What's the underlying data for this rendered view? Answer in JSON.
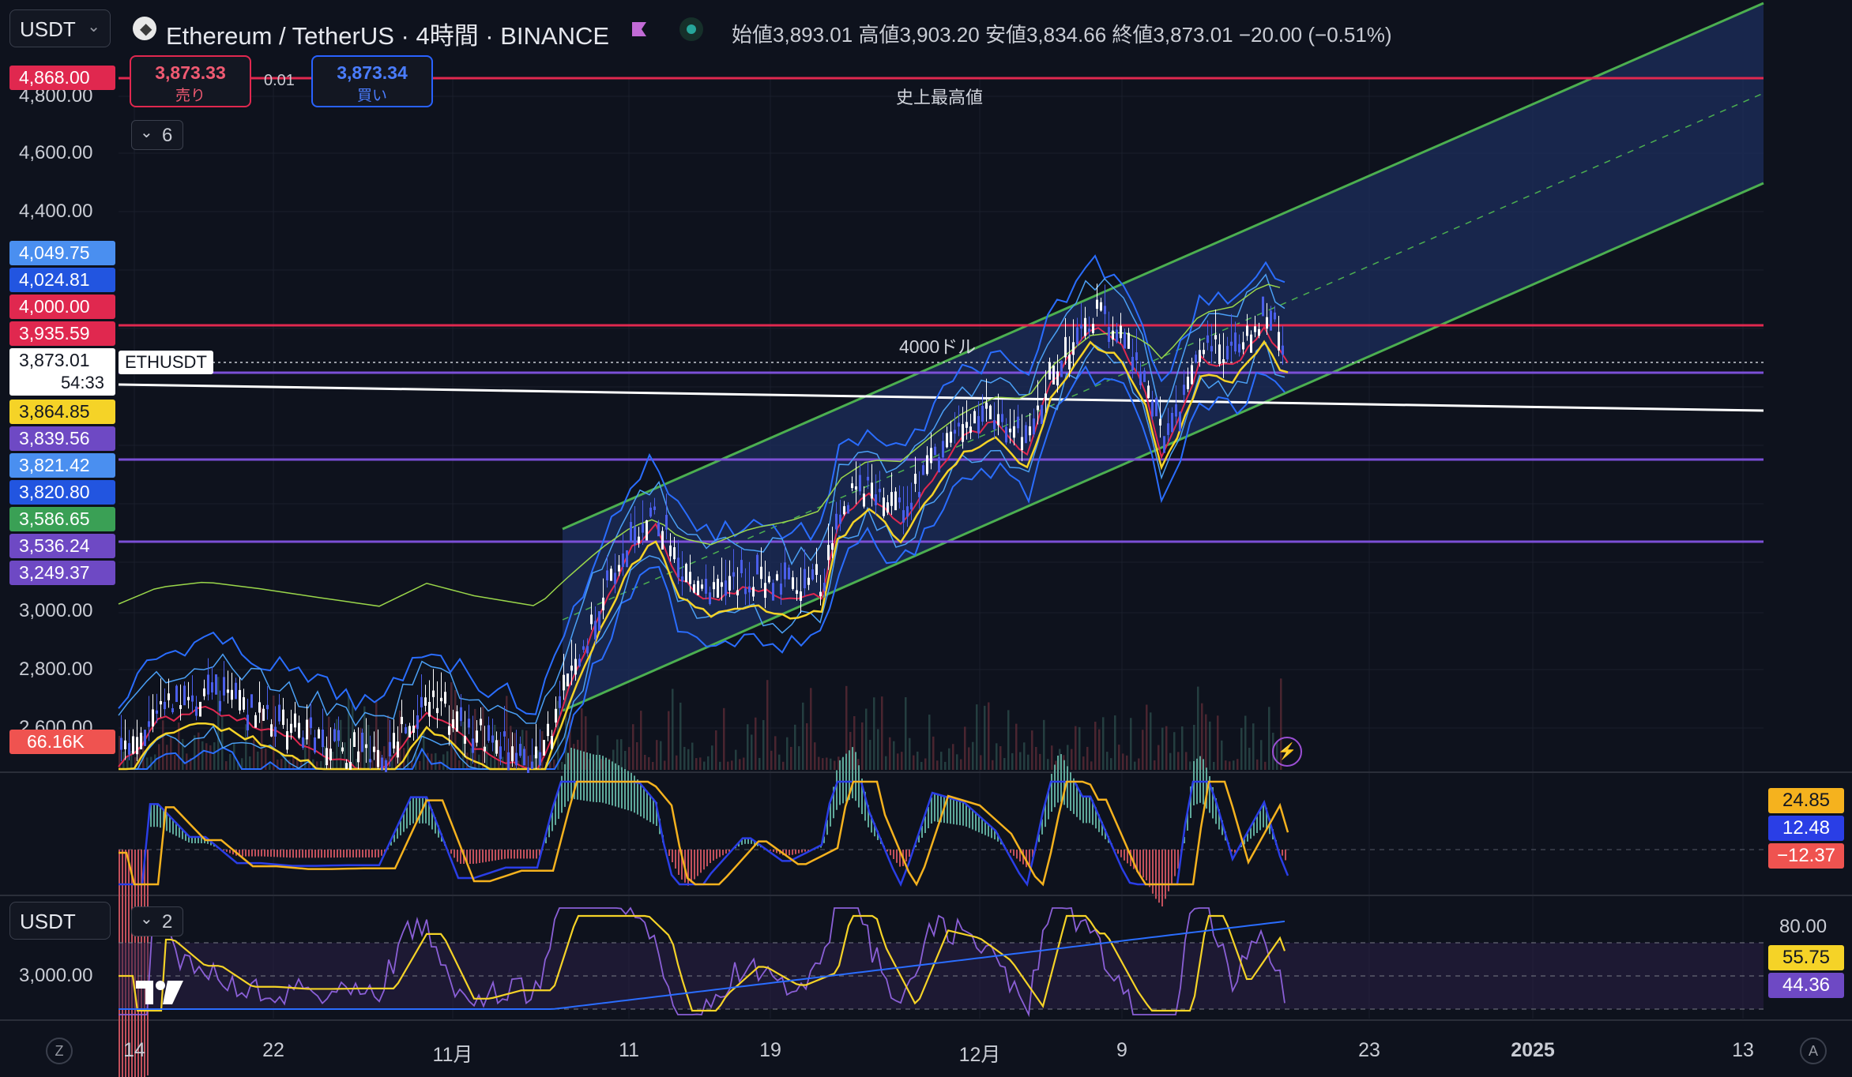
{
  "header": {
    "symbol_selector": "USDT",
    "title": "Ethereum / TetherUS · 4時間 · BINANCE",
    "ohlc": {
      "open_label": "始値",
      "open": "3,893.01",
      "high_label": "高値",
      "high": "3,903.20",
      "low_label": "安値",
      "low": "3,834.66",
      "close_label": "終値",
      "close": "3,873.01",
      "change": "−20.00 (−0.51%)"
    }
  },
  "trade": {
    "sell_price": "3,873.33",
    "sell_label": "売り",
    "spread": "0.01",
    "buy_price": "3,873.34",
    "buy_label": "買い"
  },
  "indicators_toggle": {
    "count": "6"
  },
  "annotations": {
    "ath": "史上最高値",
    "level_4000": "4000ドル"
  },
  "price_axis": [
    "4,800.00",
    "4,600.00",
    "4,400.00",
    "3,000.00",
    "2,800.00",
    "2,600.00"
  ],
  "price_tags": [
    {
      "value": "4,868.00",
      "color": "#e0284f"
    },
    {
      "value": "4,049.75",
      "color": "#4a8ff0"
    },
    {
      "value": "4,024.81",
      "color": "#2255e0"
    },
    {
      "value": "4,000.00",
      "color": "#e0284f"
    },
    {
      "value": "3,935.59",
      "color": "#e0284f"
    },
    {
      "value": "3,864.85",
      "color": "#f5d327"
    },
    {
      "value": "3,839.56",
      "color": "#6e49c4"
    },
    {
      "value": "3,821.42",
      "color": "#4a8ff0"
    },
    {
      "value": "3,820.80",
      "color": "#2255e0"
    },
    {
      "value": "3,586.65",
      "color": "#3aa055"
    },
    {
      "value": "3,536.24",
      "color": "#6e49c4"
    },
    {
      "value": "3,249.37",
      "color": "#6e49c4"
    }
  ],
  "current_price": {
    "value": "3,873.01",
    "countdown": "54:33",
    "label": "ETHUSDT"
  },
  "volume_tag": "66.16K",
  "macd_tags": [
    {
      "value": "24.85",
      "color": "#f5b21e"
    },
    {
      "value": "12.48",
      "color": "#2a3ee6"
    },
    {
      "value": "−12.37",
      "color": "#ef5350"
    }
  ],
  "rsi_pane": {
    "symbol_selector": "USDT",
    "toggle_count": "2",
    "left_axis": "3,000.00",
    "right_axis_top": "80.00",
    "tags": [
      {
        "value": "55.75",
        "color": "#f5d327"
      },
      {
        "value": "44.36",
        "color": "#6e49c4"
      }
    ]
  },
  "time_axis": [
    "14",
    "22",
    "11月",
    "11",
    "19",
    "12月",
    "9",
    "23",
    "2025",
    "13"
  ],
  "footer": {
    "left_button": "Z",
    "right_button": "A"
  },
  "logo_text": "TV",
  "colors": {
    "background": "#0e121d",
    "channel_green": "#4caf50",
    "resistance_red": "#e0284f",
    "support_purple": "#7b4fd6",
    "trend_white": "#ffffff",
    "bullish": "#ffffff",
    "bearish": "#4a5eea"
  }
}
